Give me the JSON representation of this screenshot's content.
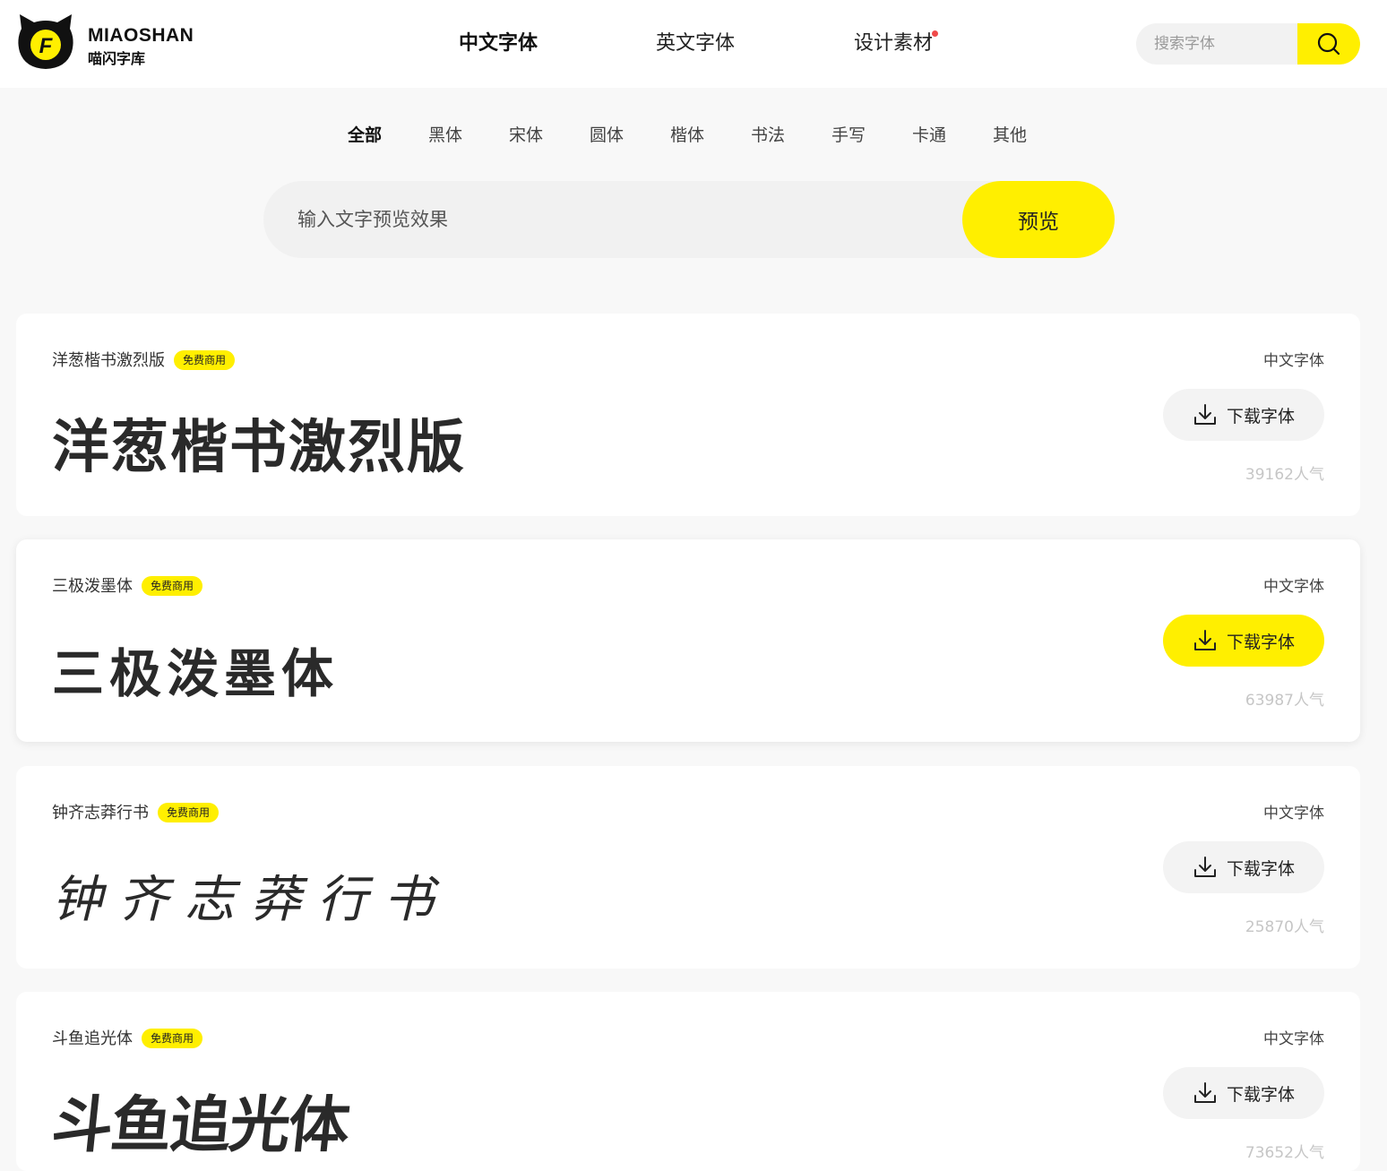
{
  "brand": {
    "name_en": "MIAOSHAN",
    "name_cn": "喵闪字库",
    "logo_letter": "F"
  },
  "colors": {
    "accent": "#ffef00",
    "dot": "#f04a4a"
  },
  "nav": {
    "items": [
      {
        "label": "中文字体"
      },
      {
        "label": "英文字体"
      },
      {
        "label": "设计素材"
      }
    ]
  },
  "search": {
    "placeholder": "搜索字体",
    "icon": "search-icon"
  },
  "categories": [
    "全部",
    "黑体",
    "宋体",
    "圆体",
    "楷体",
    "书法",
    "手写",
    "卡通",
    "其他"
  ],
  "preview": {
    "placeholder": "输入文字预览效果",
    "button": "预览"
  },
  "fonts": [
    {
      "name": "洋葱楷书激烈版",
      "badge": "免费商用",
      "category": "中文字体",
      "sample": "洋葱楷书激烈版",
      "download": "下载字体",
      "popularity": "39162人气"
    },
    {
      "name": "三极泼墨体",
      "badge": "免费商用",
      "category": "中文字体",
      "sample": "三极泼墨体",
      "download": "下载字体",
      "popularity": "63987人气"
    },
    {
      "name": "钟齐志莽行书",
      "badge": "免费商用",
      "category": "中文字体",
      "sample": "钟齐志莽行书",
      "download": "下载字体",
      "popularity": "25870人气"
    },
    {
      "name": "斗鱼追光体",
      "badge": "免费商用",
      "category": "中文字体",
      "sample": "斗鱼追光体",
      "download": "下载字体",
      "popularity": "73652人气"
    }
  ]
}
